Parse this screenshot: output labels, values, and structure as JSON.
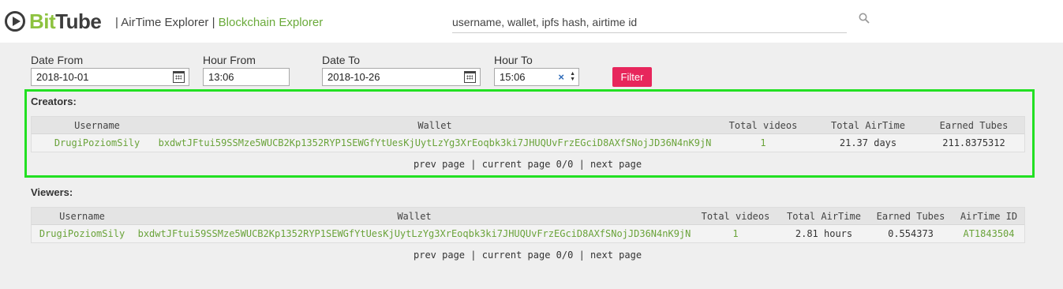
{
  "header": {
    "logo": {
      "bit": "Bit",
      "tube": "Tube"
    },
    "nav": {
      "airtime": "AirTime Explorer",
      "blockchain": "Blockchain Explorer",
      "separator": "|"
    },
    "search": {
      "placeholder": "username, wallet, ipfs hash, airtime id",
      "value": "username, wallet, ipfs hash, airtime id"
    }
  },
  "filters": {
    "date_from": {
      "label": "Date From",
      "value": "2018-10-01"
    },
    "hour_from": {
      "label": "Hour From",
      "value": "13:06"
    },
    "date_to": {
      "label": "Date To",
      "value": "2018-10-26"
    },
    "hour_to": {
      "label": "Hour To",
      "value": "15:06"
    },
    "filter_button": "Filter",
    "clear_glyph": "×"
  },
  "creators": {
    "title": "Creators:",
    "columns": [
      "Username",
      "Wallet",
      "Total videos",
      "Total AirTime",
      "Earned Tubes"
    ],
    "rows": [
      [
        "DrugiPoziomSily",
        "bxdwtJFtui59SSMze5WUCB2Kp1352RYP1SEWGfYtUesKjUytLzYg3XrEoqbk3ki7JHUQUvFrzEGciD8AXfSNojJD36N4nK9jN",
        "1",
        "21.37 days",
        "211.8375312"
      ]
    ],
    "pager": {
      "prev": "prev page",
      "current": "current page 0/0",
      "next": "next page",
      "sep": "|"
    }
  },
  "viewers": {
    "title": "Viewers:",
    "columns": [
      "Username",
      "Wallet",
      "Total videos",
      "Total AirTime",
      "Earned Tubes",
      "AirTime ID"
    ],
    "rows": [
      [
        "DrugiPoziomSily",
        "bxdwtJFtui59SSMze5WUCB2Kp1352RYP1SEWGfYtUesKjUytLzYg3XrEoqbk3ki7JHUQUvFrzEGciD8AXfSNojJD36N4nK9jN",
        "1",
        "2.81 hours",
        "0.554373",
        "AT1843504"
      ]
    ],
    "pager": {
      "prev": "prev page",
      "current": "current page 0/0",
      "next": "next page",
      "sep": "|"
    }
  },
  "colors": {
    "brand_green": "#8dc23f",
    "link_green": "#6aa33a",
    "filter_red": "#e7265c",
    "highlight": "#22e022"
  }
}
